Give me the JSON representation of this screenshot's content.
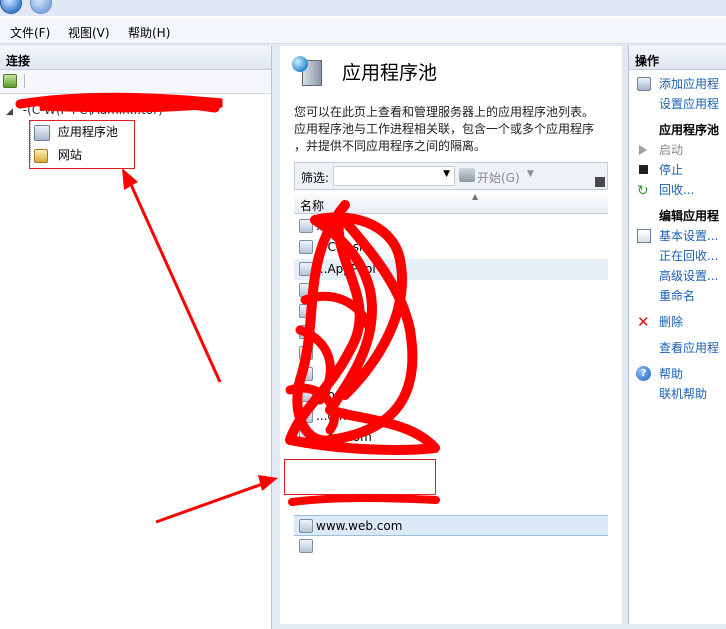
{
  "menubar": {
    "file": "文件(F)",
    "view": "视图(V)",
    "help": "帮助(H)"
  },
  "connections": {
    "title": "连接",
    "server_label": "-(C-W(P-PC\\Admin...tor)",
    "items": [
      {
        "label": "应用程序池",
        "icon": "app-pool-icon"
      },
      {
        "label": "网站",
        "icon": "sites-icon"
      }
    ]
  },
  "main": {
    "title": "应用程序池",
    "description": [
      "您可以在此页上查看和管理服务器上的应用程序池列表。",
      "应用程序池与工作进程相关联，包含一个或多个应用程序",
      "，并提供不同应用程序之间的隔离。"
    ],
    "filter_label": "筛选:",
    "start_label": "开始(G)",
    "column_name": "名称",
    "rows": [
      {
        "label": "...ET..."
      },
      {
        "label": "...Classic"
      },
      {
        "label": "...AppPool"
      },
      {
        "label": ""
      },
      {
        "label": ""
      },
      {
        "label": ""
      },
      {
        "label": ""
      },
      {
        "label": ""
      },
      {
        "label": "...om"
      },
      {
        "label": "...om"
      },
      {
        "label": "...ou.com"
      },
      {
        "label": "www.web.com"
      },
      {
        "label": ""
      }
    ],
    "selected_row": "www.web.com"
  },
  "actions": {
    "title": "操作",
    "add_pool": "添加应用程",
    "set_default": "设置应用程",
    "group_pool": "应用程序池",
    "start": "启动",
    "stop": "停止",
    "recycle": "回收...",
    "group_edit": "编辑应用程",
    "basic_settings": "基本设置...",
    "recycling": "正在回收...",
    "advanced": "高级设置...",
    "rename": "重命名",
    "delete": "删除",
    "view_apps": "查看应用程",
    "help": "帮助",
    "online_help": "联机帮助"
  },
  "colors": {
    "accent": "#1a5fb4",
    "annotation": "#ff0000"
  }
}
